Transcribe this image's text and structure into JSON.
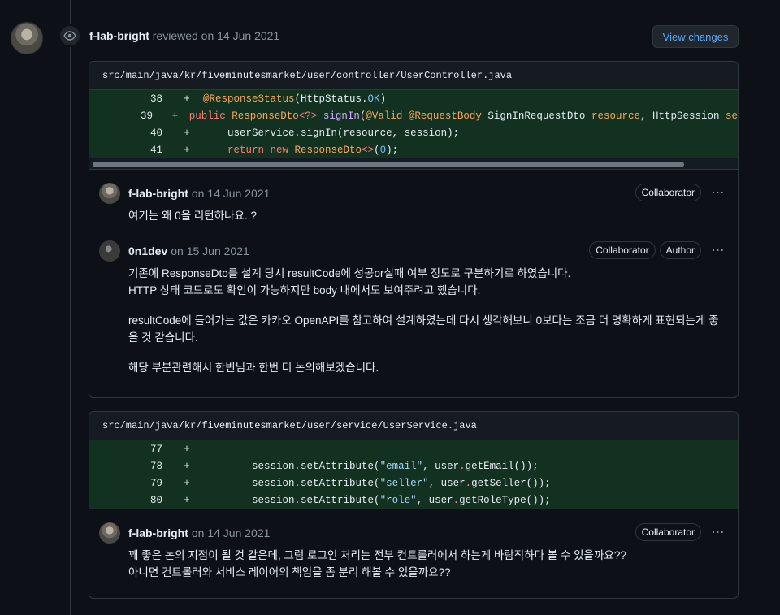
{
  "review": {
    "author": "f-lab-bright",
    "action": "reviewed on 14 Jun 2021",
    "view_changes": "View changes"
  },
  "threads": [
    {
      "file": "src/main/java/kr/fiveminutesmarket/user/controller/UserController.java",
      "lines": [
        {
          "num": "38",
          "sign": "+"
        },
        {
          "num": "39",
          "sign": "+"
        },
        {
          "num": "40",
          "sign": "+"
        },
        {
          "num": "41",
          "sign": "+"
        }
      ],
      "comments": [
        {
          "author": "f-lab-bright",
          "date": "on 14 Jun 2021",
          "badges": [
            "Collaborator"
          ],
          "paragraphs": [
            "여기는 왜 0을 리턴하나요..?"
          ]
        },
        {
          "author": "0n1dev",
          "date": "on 15 Jun 2021",
          "badges": [
            "Collaborator",
            "Author"
          ],
          "paragraphs": [
            "기존에 ResponseDto를 설계 당시 resultCode에 성공or실패 여부 정도로 구분하기로 하였습니다.\nHTTP 상태 코드로도 확인이 가능하지만 body 내에서도 보여주려고 했습니다.",
            "resultCode에 들어가는 값은 카카오 OpenAPI를 참고하여 설계하였는데 다시 생각해보니 0보다는 조금 더 명확하게 표현되는게 좋을 것 같습니다.",
            "해당 부분관련해서 한빈님과 한번 더 논의해보겠습니다."
          ]
        }
      ]
    },
    {
      "file": "src/main/java/kr/fiveminutesmarket/user/service/UserService.java",
      "lines": [
        {
          "num": "77",
          "sign": "+"
        },
        {
          "num": "78",
          "sign": "+"
        },
        {
          "num": "79",
          "sign": "+"
        },
        {
          "num": "80",
          "sign": "+"
        }
      ],
      "comments": [
        {
          "author": "f-lab-bright",
          "date": "on 14 Jun 2021",
          "badges": [
            "Collaborator"
          ],
          "paragraphs": [
            "꽤 좋은 논의 지점이 될 것 같은데, 그럼 로그인 처리는 전부 컨트롤러에서 하는게 바람직하다 볼 수 있을까요??\n아니면 컨트롤러와 서비스 레이어의 책임을 좀 분리 해볼 수 있을까요??"
          ]
        }
      ]
    }
  ],
  "icons": {
    "kebab": "kebab-horizontal-icon",
    "eye": "eye-icon"
  }
}
